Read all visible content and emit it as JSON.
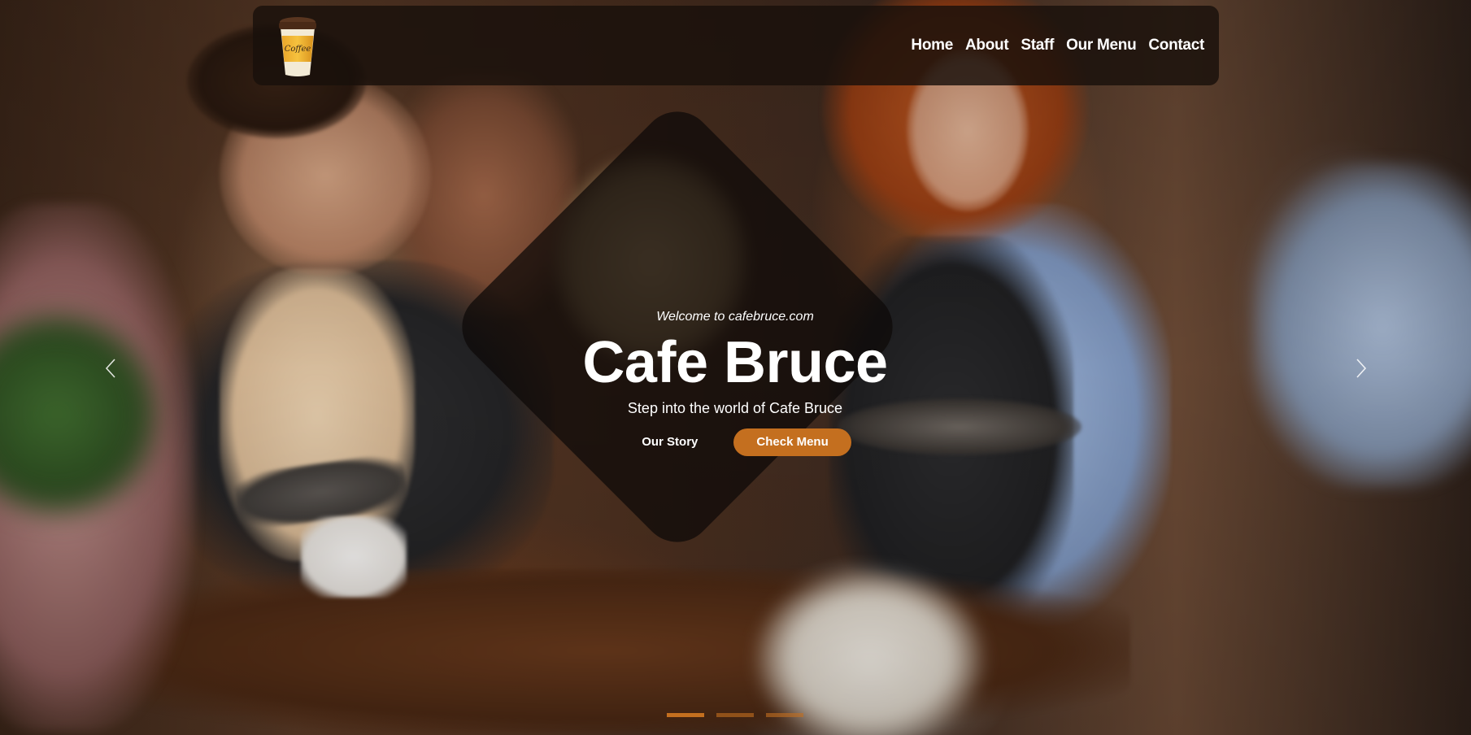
{
  "brand": {
    "logo_text": "Coffee",
    "accent_color": "#c46f1f"
  },
  "nav": {
    "items": [
      {
        "label": "Home"
      },
      {
        "label": "About"
      },
      {
        "label": "Staff"
      },
      {
        "label": "Our Menu"
      },
      {
        "label": "Contact"
      }
    ]
  },
  "hero": {
    "welcome": "Welcome to cafebruce.com",
    "title": "Cafe Bruce",
    "subtitle": "Step into the world of Cafe Bruce",
    "secondary_button": "Our Story",
    "primary_button": "Check Menu"
  },
  "carousel": {
    "prev_icon": "chevron-left-icon",
    "next_icon": "chevron-right-icon",
    "slide_count": 3,
    "active_index": 0
  }
}
